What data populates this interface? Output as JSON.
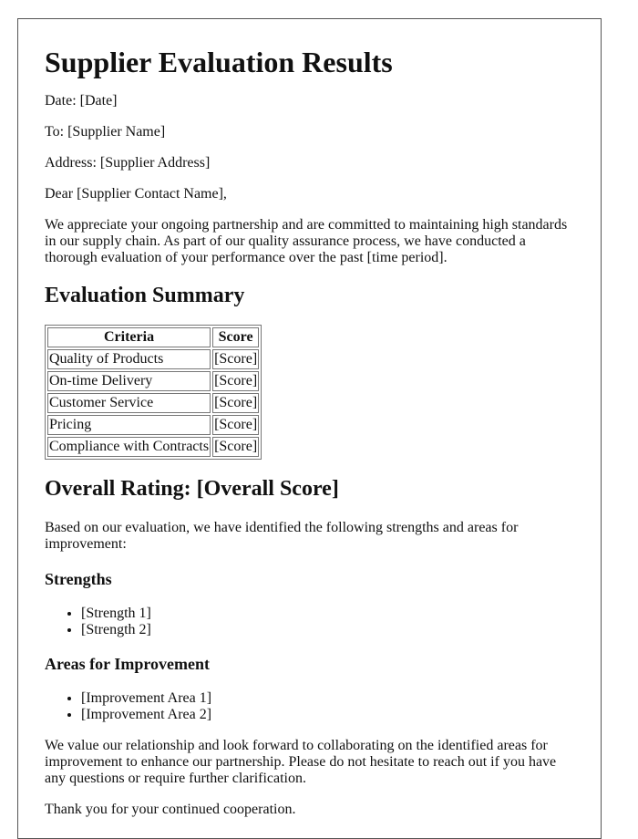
{
  "title": "Supplier Evaluation Results",
  "header_fields": {
    "date": "Date: [Date]",
    "to": "To: [Supplier Name]",
    "address": "Address: [Supplier Address]",
    "salutation": "Dear [Supplier Contact Name],"
  },
  "intro": "We appreciate your ongoing partnership and are committed to maintaining high standards in our supply chain. As part of our quality assurance process, we have conducted a thorough evaluation of your performance over the past [time period].",
  "summary": {
    "heading": "Evaluation Summary",
    "columns": [
      "Criteria",
      "Score"
    ],
    "rows": [
      {
        "criteria": "Quality of Products",
        "score": "[Score]"
      },
      {
        "criteria": "On-time Delivery",
        "score": "[Score]"
      },
      {
        "criteria": "Customer Service",
        "score": "[Score]"
      },
      {
        "criteria": "Pricing",
        "score": "[Score]"
      },
      {
        "criteria": "Compliance with Contracts",
        "score": "[Score]"
      }
    ]
  },
  "overall": "Overall Rating: [Overall Score]",
  "findings_intro": "Based on our evaluation, we have identified the following strengths and areas for improvement:",
  "strengths": {
    "heading": "Strengths",
    "items": [
      "[Strength 1]",
      "[Strength 2]"
    ]
  },
  "improvements": {
    "heading": "Areas for Improvement",
    "items": [
      "[Improvement Area 1]",
      "[Improvement Area 2]"
    ]
  },
  "closing": "We value our relationship and look forward to collaborating on the identified areas for improvement to enhance our partnership. Please do not hesitate to reach out if you have any questions or require further clarification.",
  "signoff": "Thank you for your continued cooperation."
}
